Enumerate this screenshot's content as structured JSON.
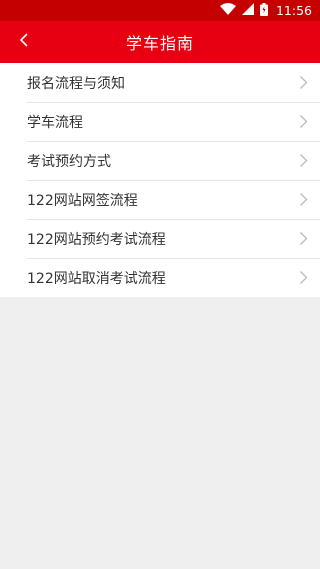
{
  "status_bar": {
    "time": "11:56",
    "bg_color": "#c40000",
    "icons": [
      "wifi-icon",
      "signal-icon",
      "battery-icon"
    ]
  },
  "header": {
    "title": "学车指南",
    "back_icon": "chevron-left-icon",
    "bg_color": "#e60012"
  },
  "list": {
    "items": [
      {
        "label": "报名流程与须知"
      },
      {
        "label": "学车流程"
      },
      {
        "label": "考试预约方式"
      },
      {
        "label": "122网站网签流程"
      },
      {
        "label": "122网站预约考试流程"
      },
      {
        "label": "122网站取消考试流程"
      }
    ],
    "chevron_icon": "chevron-right-icon"
  }
}
